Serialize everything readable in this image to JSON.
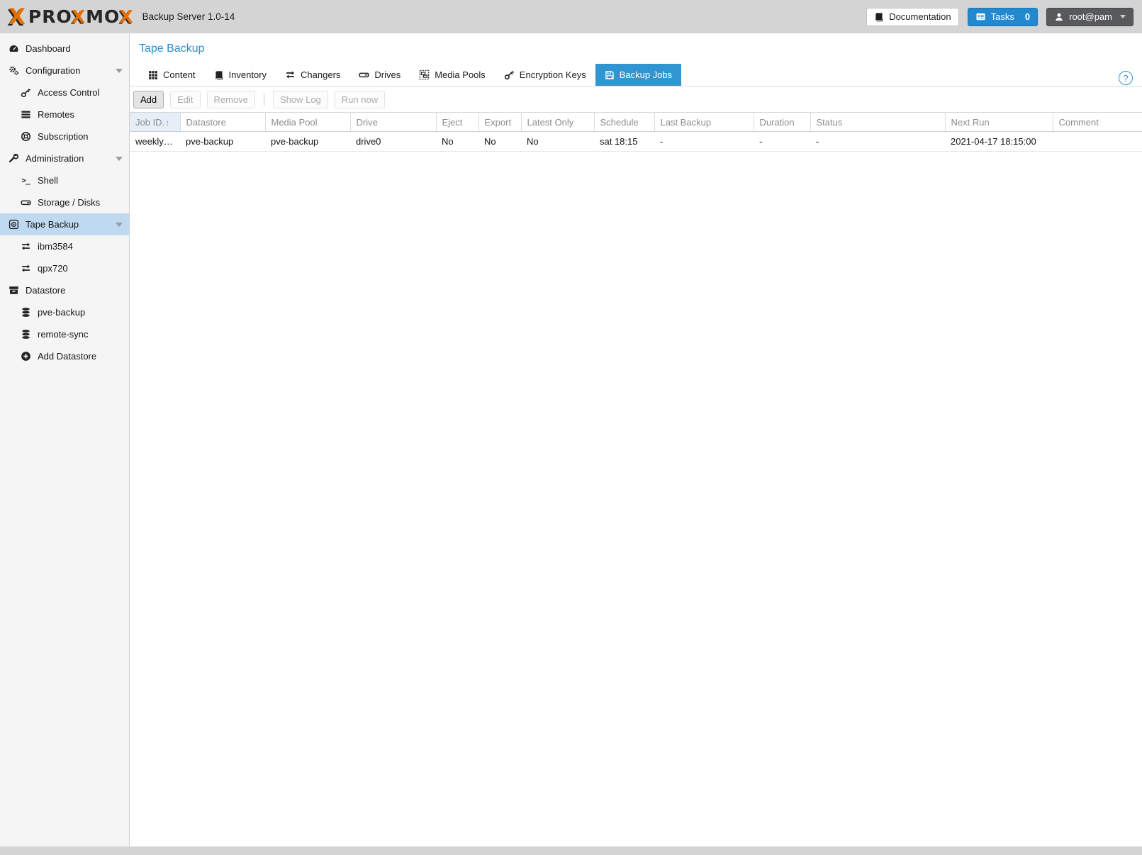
{
  "header": {
    "logo": {
      "mark": "X",
      "seg1": "PRO",
      "seg2": "X",
      "seg3": "MO",
      "seg4": "X"
    },
    "product": "Backup Server 1.0-14",
    "documentation_label": "Documentation",
    "tasks_label": "Tasks",
    "tasks_count": "0",
    "user_label": "root@pam"
  },
  "sidebar": {
    "items": [
      {
        "label": "Dashboard"
      },
      {
        "label": "Configuration"
      },
      {
        "label": "Access Control"
      },
      {
        "label": "Remotes"
      },
      {
        "label": "Subscription"
      },
      {
        "label": "Administration"
      },
      {
        "label": "Shell"
      },
      {
        "label": "Storage / Disks"
      },
      {
        "label": "Tape Backup"
      },
      {
        "label": "ibm3584"
      },
      {
        "label": "qpx720"
      },
      {
        "label": "Datastore"
      },
      {
        "label": "pve-backup"
      },
      {
        "label": "remote-sync"
      },
      {
        "label": "Add Datastore"
      }
    ]
  },
  "main": {
    "title": "Tape Backup",
    "help_glyph": "?",
    "tabs": [
      {
        "label": "Content"
      },
      {
        "label": "Inventory"
      },
      {
        "label": "Changers"
      },
      {
        "label": "Drives"
      },
      {
        "label": "Media Pools"
      },
      {
        "label": "Encryption Keys"
      },
      {
        "label": "Backup Jobs"
      }
    ],
    "toolbar": {
      "add": "Add",
      "edit": "Edit",
      "remove": "Remove",
      "show_log": "Show Log",
      "run_now": "Run now"
    },
    "table": {
      "sort_glyph": "↑",
      "columns": [
        "Job ID.",
        "Datastore",
        "Media Pool",
        "Drive",
        "Eject",
        "Export",
        "Latest Only",
        "Schedule",
        "Last Backup",
        "Duration",
        "Status",
        "Next Run",
        "Comment"
      ],
      "rows": [
        {
          "job_id": "weekly…",
          "datastore": "pve-backup",
          "media_pool": "pve-backup",
          "drive": "drive0",
          "eject": "No",
          "export": "No",
          "latest_only": "No",
          "schedule": "sat 18:15",
          "last_backup": "-",
          "duration": "-",
          "status": "-",
          "next_run": "2021-04-17 18:15:00",
          "comment": ""
        }
      ]
    }
  },
  "icons": {
    "shell_glyph": ">_"
  },
  "colors": {
    "accent_blue": "#2a8fd0",
    "tab_active_blue": "#3195d2",
    "tasks_button_blue": "#2289ce",
    "selected_nav_blue": "#bed9f0",
    "brand_orange": "#e57000",
    "topbar_gray": "#d4d4d4"
  }
}
